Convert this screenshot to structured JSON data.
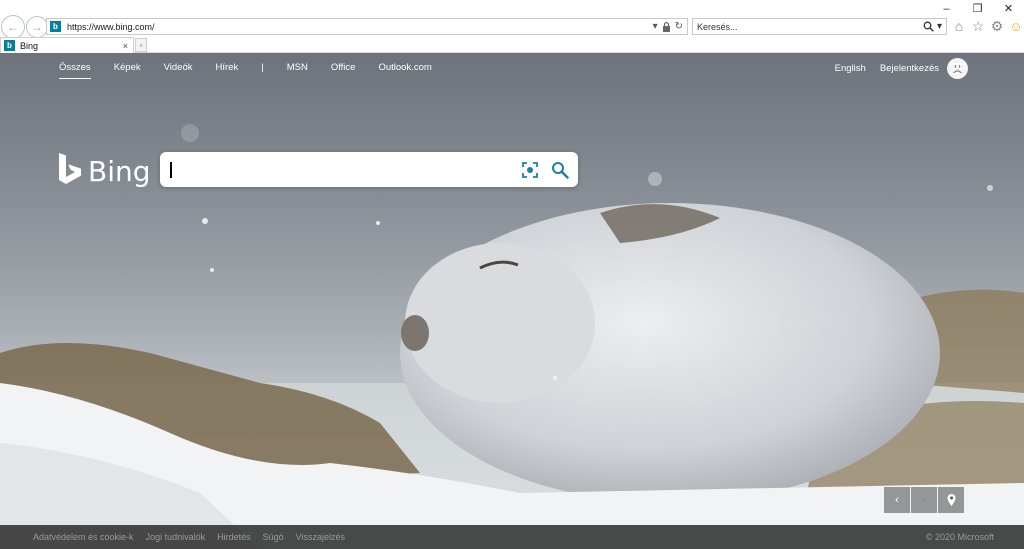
{
  "browser": {
    "window_controls": {
      "minimize": "–",
      "maximize": "❐",
      "close": "✕"
    },
    "address": {
      "url": "https://www.bing.com/"
    },
    "search": {
      "placeholder": "Keresés..."
    },
    "tab": {
      "title": "Bing",
      "close": "×"
    }
  },
  "nav": {
    "items": [
      "Összes",
      "Képek",
      "Videók",
      "Hírek",
      "|",
      "MSN",
      "Office",
      "Outlook.com"
    ],
    "active": "Összes",
    "lang": "English",
    "signin": "Bejelentkezés"
  },
  "brand": {
    "name": "Bing"
  },
  "search": {
    "value": ""
  },
  "footer": {
    "links": [
      "Adatvédelem és cookie-k",
      "Jogi tudnivalók",
      "Hirdetés",
      "Súgó",
      "Visszajelzés"
    ],
    "copyright": "© 2020 Microsoft"
  },
  "colors": {
    "brand_teal": "#00809d",
    "search_icon": "#1c7fa6"
  }
}
